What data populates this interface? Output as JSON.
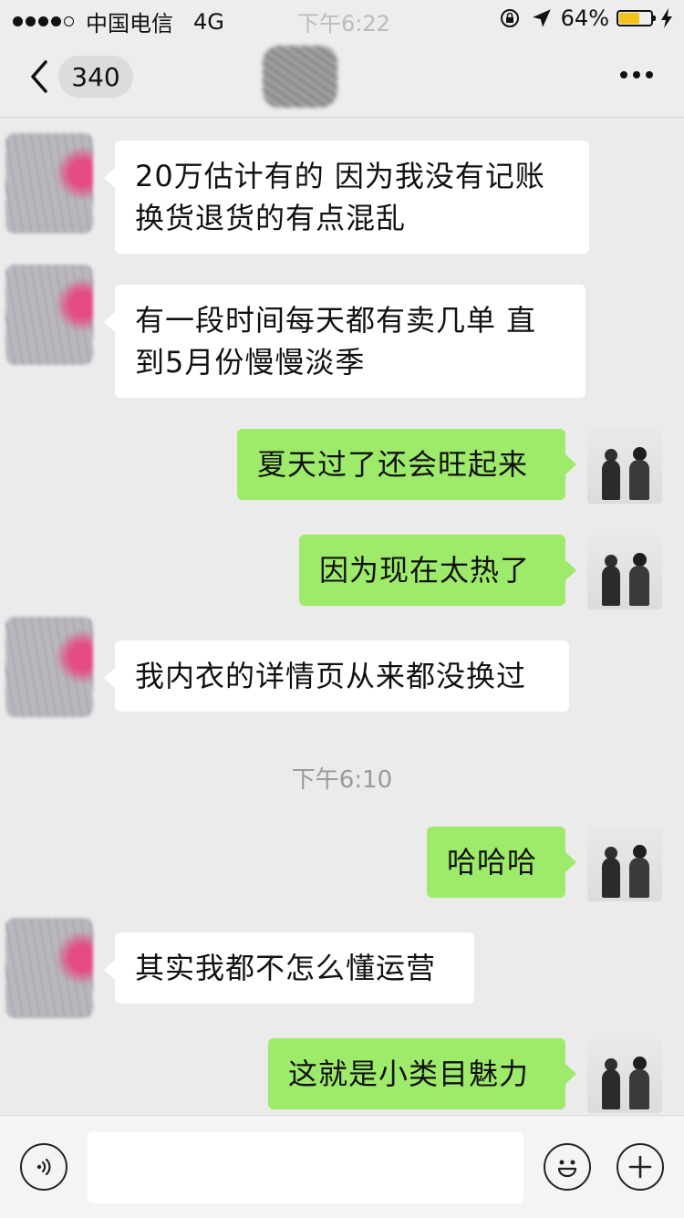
{
  "status_bar": {
    "carrier": "中国电信",
    "network": "4G",
    "time": "下午6:22",
    "battery": "64%",
    "battery_level": 0.64
  },
  "nav": {
    "unread_count": "340"
  },
  "messages": [
    {
      "side": "left",
      "text": "20万估计有的 因为我没有记账\n换货退货的有点混乱"
    },
    {
      "side": "left",
      "text": "有一段时间每天都有卖几单  直\n到5月份慢慢淡季"
    },
    {
      "side": "right",
      "text": "夏天过了还会旺起来"
    },
    {
      "side": "right",
      "text": "因为现在太热了"
    },
    {
      "side": "left",
      "text": "我内衣的详情页从来都没换过"
    },
    {
      "side": "right",
      "text": "哈哈哈"
    },
    {
      "side": "left",
      "text": "其实我都不怎么懂运营"
    },
    {
      "side": "right",
      "text": "这就是小类目魅力"
    }
  ],
  "timestamp": "下午6:10",
  "input": {
    "value": ""
  },
  "icons": {
    "voice": "voice-icon",
    "emoji": "emoji-icon",
    "plus": "plus-icon",
    "back": "chevron-left-icon",
    "more": "more-icon"
  }
}
